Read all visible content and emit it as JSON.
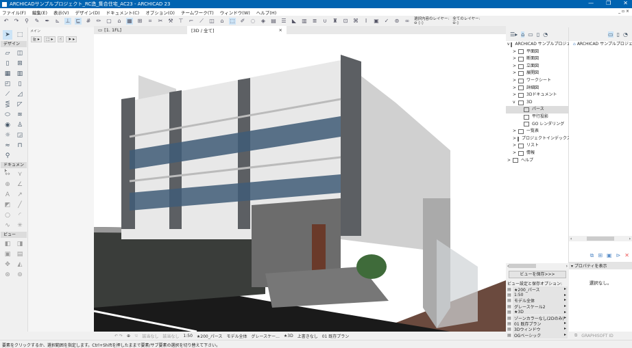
{
  "window": {
    "title": "ARCHICADサンプルプロジェクト_RC造_集合住宅_AC23 - ARCHICAD 23",
    "controls": [
      "—",
      "❐",
      "✕"
    ]
  },
  "menu": [
    "ファイル(F)",
    "編集(E)",
    "表示(V)",
    "デザイン(D)",
    "ドキュメント(C)",
    "オプション(O)",
    "チームワーク(T)",
    "ウィンドウ(W)",
    "ヘルプ(H)"
  ],
  "toolbar": {
    "selected_layers_label": "選択内容のレイヤー:",
    "all_layers_label": "全てのレイヤー:"
  },
  "tabs": [
    {
      "label": "[1. 1FL]"
    },
    {
      "label": "[3D / 全て]"
    }
  ],
  "toolbox": {
    "main_label": "メイン",
    "design_label": "デザイン",
    "document_label": "ドキュメント",
    "view_label": "ビュー"
  },
  "navigator": {
    "root": "ARCHICAD サンプルプロジェクト",
    "items": [
      {
        "label": "平面図",
        "level": 1,
        "expander": ">"
      },
      {
        "label": "断面図",
        "level": 1,
        "expander": ">"
      },
      {
        "label": "立面図",
        "level": 1,
        "expander": ">"
      },
      {
        "label": "展開図",
        "level": 1,
        "expander": ">"
      },
      {
        "label": "ワークシート",
        "level": 1,
        "expander": ">"
      },
      {
        "label": "詳細図",
        "level": 1,
        "expander": ">"
      },
      {
        "label": "3Dドキュメント",
        "level": 1,
        "expander": ">"
      },
      {
        "label": "3D",
        "level": 1,
        "expander": "v"
      },
      {
        "label": "パース",
        "level": 2,
        "expander": ""
      },
      {
        "label": "平行投影",
        "level": 2,
        "expander": ""
      },
      {
        "label": "GO レンダリング",
        "level": 2,
        "expander": ""
      },
      {
        "label": "一覧表",
        "level": 1,
        "expander": ">"
      },
      {
        "label": "プロジェクトインデックス",
        "level": 1,
        "expander": ">"
      },
      {
        "label": "リスト",
        "level": 1,
        "expander": ">"
      },
      {
        "label": "情報",
        "level": 1,
        "expander": ">"
      },
      {
        "label": "ヘルプ",
        "level": 0,
        "expander": ">"
      }
    ],
    "selected_index": 8,
    "right_root": "ARCHICAD サンプルプロジェクト"
  },
  "views": {
    "save_button": "ビューを保存>>>",
    "options_label": "ビュー設定と保存オプション:",
    "options": [
      "★200_パース",
      "1:50",
      "モデル全体",
      "グレースケール2",
      "★3D",
      "ゾーンカラーなし(2Dのみ)",
      "01 既存プラン",
      "3Dウィンドウ",
      "OGベーシック"
    ]
  },
  "properties": {
    "header": "プロパティを表示",
    "empty": "選択なし。"
  },
  "viewbar": {
    "none1": "該当なし",
    "none2": "該当なし",
    "scale": "1:50",
    "view": "★200_パース",
    "model": "モデル全体",
    "pen": "グレースケー...",
    "style": "★3D",
    "override": "上書きなし",
    "reno": "01 既存プラン"
  },
  "graphisoft_id": "GRAPHISOFT ID",
  "status": "要素をクリックするか、選択範囲を指定します。Ctrl+Shiftを押したままで要素/サブ要素の選択を切り替えて下さい。"
}
